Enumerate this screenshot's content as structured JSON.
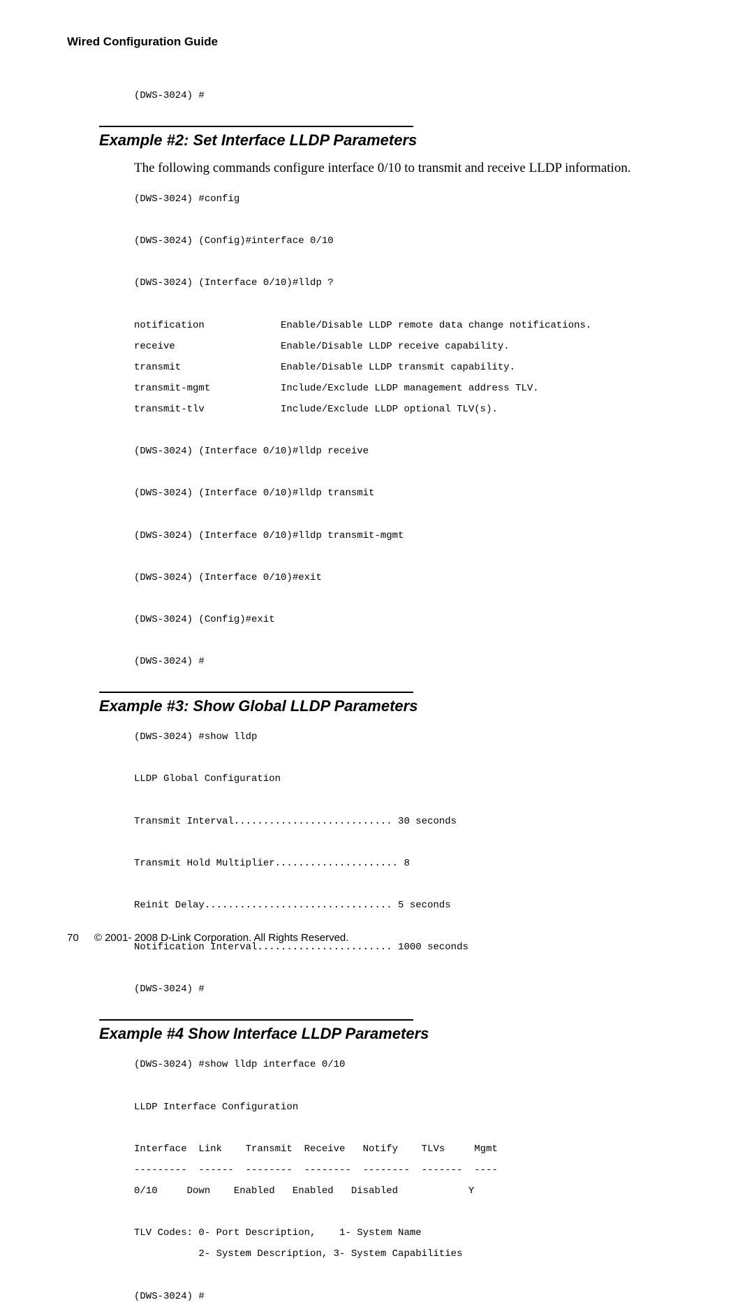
{
  "header": {
    "running_title": "Wired Configuration Guide"
  },
  "pre_block": "(DWS-3024) #",
  "example2": {
    "title": "Example #2: Set Interface LLDP Parameters",
    "intro": "The following commands configure interface 0/10 to transmit and receive LLDP information.",
    "code": "(DWS-3024) #config\n\n(DWS-3024) (Config)#interface 0/10\n\n(DWS-3024) (Interface 0/10)#lldp ?\n\nnotification             Enable/Disable LLDP remote data change notifications.\nreceive                  Enable/Disable LLDP receive capability.\ntransmit                 Enable/Disable LLDP transmit capability.\ntransmit-mgmt            Include/Exclude LLDP management address TLV.\ntransmit-tlv             Include/Exclude LLDP optional TLV(s).\n\n(DWS-3024) (Interface 0/10)#lldp receive\n\n(DWS-3024) (Interface 0/10)#lldp transmit\n\n(DWS-3024) (Interface 0/10)#lldp transmit-mgmt\n\n(DWS-3024) (Interface 0/10)#exit\n\n(DWS-3024) (Config)#exit\n\n(DWS-3024) #"
  },
  "example3": {
    "title": "Example #3: Show Global LLDP Parameters",
    "code": "(DWS-3024) #show lldp\n\nLLDP Global Configuration\n\nTransmit Interval........................... 30 seconds\n\nTransmit Hold Multiplier..................... 8\n\nReinit Delay................................ 5 seconds\n\nNotification Interval....................... 1000 seconds\n\n(DWS-3024) #"
  },
  "example4": {
    "title": "Example #4 Show Interface LLDP Parameters",
    "code": "(DWS-3024) #show lldp interface 0/10\n\nLLDP Interface Configuration\n\nInterface  Link    Transmit  Receive   Notify    TLVs     Mgmt\n---------  ------  --------  --------  --------  -------  ----\n0/10     Down    Enabled   Enabled   Disabled            Y\n\nTLV Codes: 0- Port Description,    1- System Name\n           2- System Description, 3- System Capabilities\n\n(DWS-3024) #"
  },
  "footer": {
    "page_number": "70",
    "copyright": "© 2001- 2008 D-Link Corporation. All Rights Reserved."
  }
}
